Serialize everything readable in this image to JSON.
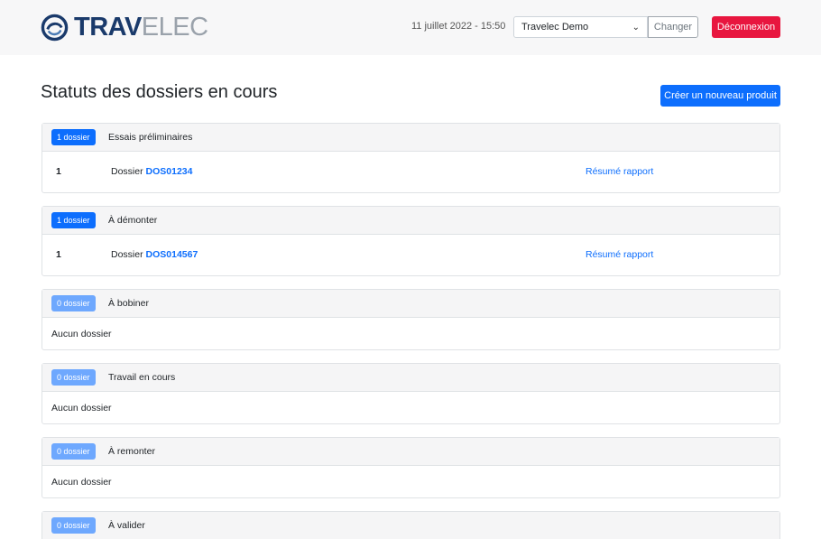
{
  "header": {
    "logo_part1": "TRAV",
    "logo_part2": "ELEC",
    "datetime": "11 juillet 2022 - 15:50",
    "org_selected": "Travelec Demo",
    "change_label": "Changer",
    "logout_label": "Déconnexion"
  },
  "main": {
    "title": "Statuts des dossiers en cours",
    "create_label": "Créer un nouveau produit",
    "cards": [
      {
        "badge": "1 dossier",
        "title": "Essais préliminaires",
        "row": {
          "num": "1",
          "prefix": "Dossier",
          "id": "DOS01234",
          "link": "Résumé rapport"
        }
      },
      {
        "badge": "1 dossier",
        "title": "À démonter",
        "row": {
          "num": "1",
          "prefix": "Dossier",
          "id": "DOS014567",
          "link": "Résumé rapport"
        }
      },
      {
        "badge": "0 dossier",
        "title": "À bobiner",
        "empty": "Aucun dossier"
      },
      {
        "badge": "0 dossier",
        "title": "Travail en cours",
        "empty": "Aucun dossier"
      },
      {
        "badge": "0 dossier",
        "title": "À remonter",
        "empty": "Aucun dossier"
      },
      {
        "badge": "0 dossier",
        "title": "À valider"
      }
    ]
  },
  "colors": {
    "primary": "#0d6efd",
    "danger": "#e8163f",
    "badge_light": "#6ea8fe",
    "logo_dark": "#1a3a6b",
    "logo_light": "#9aa2ab"
  },
  "icons": {
    "logo": "travelec-logo-icon",
    "select": "chevron-down-icon"
  }
}
